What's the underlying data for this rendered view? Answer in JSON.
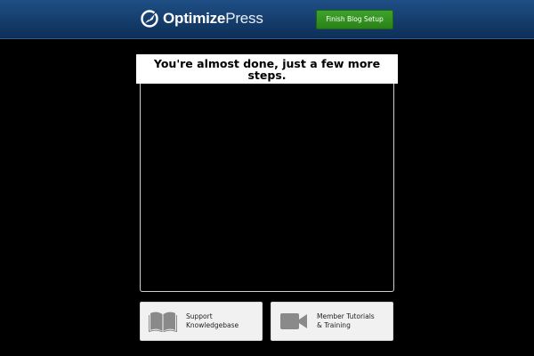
{
  "header": {
    "logo": {
      "bold_part": "Optimize",
      "light_part": "Press",
      "icon": "optimizepress-logo-icon"
    },
    "finish_button": "Finish Blog Setup"
  },
  "main": {
    "title": "You're almost done, just a few more steps."
  },
  "cards": [
    {
      "label": "Support\nKnowledgebase",
      "icon": "book-icon"
    },
    {
      "label": "Member Tutorials\n& Training",
      "icon": "video-camera-icon"
    }
  ],
  "colors": {
    "header_bg": "#143b69",
    "button_green": "#3fa22b",
    "background": "#000000",
    "card_bg": "#f1f1f1",
    "icon_gray": "#8a8a8a"
  }
}
